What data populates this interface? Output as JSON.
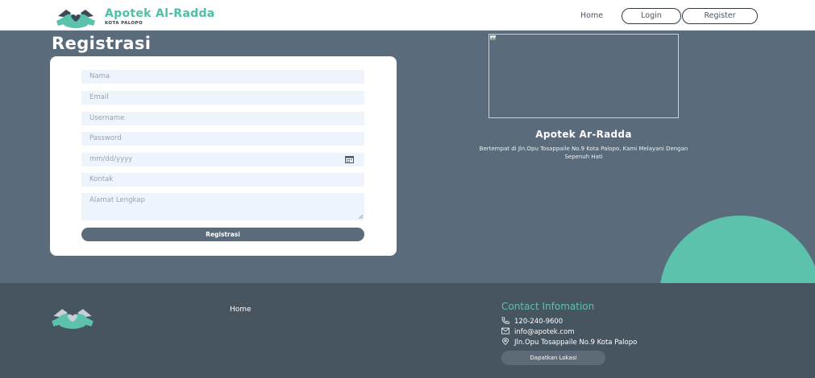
{
  "header": {
    "brand_name": "Apotek Al-Radda",
    "brand_sub": "KOTA PALOPO",
    "nav_home": "Home",
    "nav_login": "Login",
    "nav_register": "Register"
  },
  "page_title": "Registrasi",
  "form": {
    "nama_placeholder": "Nama",
    "email_placeholder": "Email",
    "username_placeholder": "Username",
    "password_placeholder": "Password",
    "date_placeholder": "mm/dd/yyyy",
    "kontak_placeholder": "Kontak",
    "alamat_placeholder": "Alamat Lengkap",
    "submit_label": "Registrasi"
  },
  "side": {
    "title": "Apotek Ar-Radda",
    "description": "Bertempat di Jln.Opu Tosappaile No.9 Kota Palopo, Kami Melayani Dengan Sepenuh Hati"
  },
  "footer": {
    "home": "Home",
    "contact_title": "Contact Infomation",
    "phone": "120-240-9600",
    "email": "info@apotek.com",
    "address": "Jln.Opu Tosappaile No.9 Kota Palopo",
    "location_button": "Dapatkan Lokasi"
  },
  "colors": {
    "teal": "#5cc2ab",
    "slate": "#5a6b7b",
    "footer_bg": "#475561",
    "field_bg": "#eef4fb"
  },
  "icons": [
    "hands-heart-logo-icon",
    "calendar-icon",
    "broken-image-icon",
    "phone-icon",
    "mail-icon",
    "location-pin-icon"
  ]
}
